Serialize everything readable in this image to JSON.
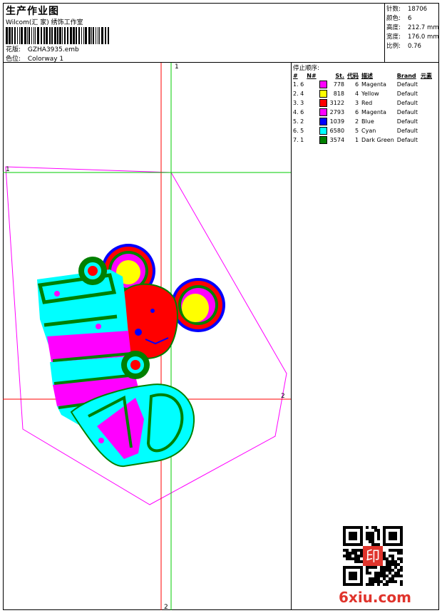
{
  "header": {
    "title": "生产作业图",
    "studio": "Wilcom(汇 家) 绣饰工作室",
    "design_label": "花版:",
    "design_value": "GZHA3935.emb",
    "colorway_label": "色位:",
    "colorway_value": "Colorway 1"
  },
  "stats": [
    {
      "label": "针数:",
      "value": "18706"
    },
    {
      "label": "颜色:",
      "value": "6"
    },
    {
      "label": "高度:",
      "value": "212.7 mm"
    },
    {
      "label": "宽度:",
      "value": "176.0 mm"
    },
    {
      "label": "比例:",
      "value": "0.76"
    }
  ],
  "sequence": {
    "title": "停止顺序:",
    "headers": {
      "hash": "#",
      "n": "N#",
      "st": "St.",
      "code": "代码",
      "desc": "描述",
      "brand": "Brand",
      "element": "元素"
    },
    "rows": [
      {
        "idx": "1. 6",
        "color": "#ff00ff",
        "stitches": "778",
        "code": "6",
        "desc": "Magenta",
        "brand": "Default"
      },
      {
        "idx": "2. 4",
        "color": "#ffff00",
        "stitches": "818",
        "code": "4",
        "desc": "Yellow",
        "brand": "Default"
      },
      {
        "idx": "3. 3",
        "color": "#ff0000",
        "stitches": "3122",
        "code": "3",
        "desc": "Red",
        "brand": "Default"
      },
      {
        "idx": "4. 6",
        "color": "#ff00ff",
        "stitches": "2793",
        "code": "6",
        "desc": "Magenta",
        "brand": "Default"
      },
      {
        "idx": "5. 2",
        "color": "#0000ff",
        "stitches": "1039",
        "code": "2",
        "desc": "Blue",
        "brand": "Default"
      },
      {
        "idx": "6. 5",
        "color": "#00ffff",
        "stitches": "6580",
        "code": "5",
        "desc": "Cyan",
        "brand": "Default"
      },
      {
        "idx": "7. 1",
        "color": "#008000",
        "stitches": "3574",
        "code": "1",
        "desc": "Dark Green",
        "brand": "Default"
      }
    ]
  },
  "canvas": {
    "axis_labels": {
      "top": "1",
      "left": "1",
      "right": "2",
      "bottom": "2"
    }
  },
  "watermark": {
    "text": "6xiu.com",
    "seal_text": "印"
  }
}
